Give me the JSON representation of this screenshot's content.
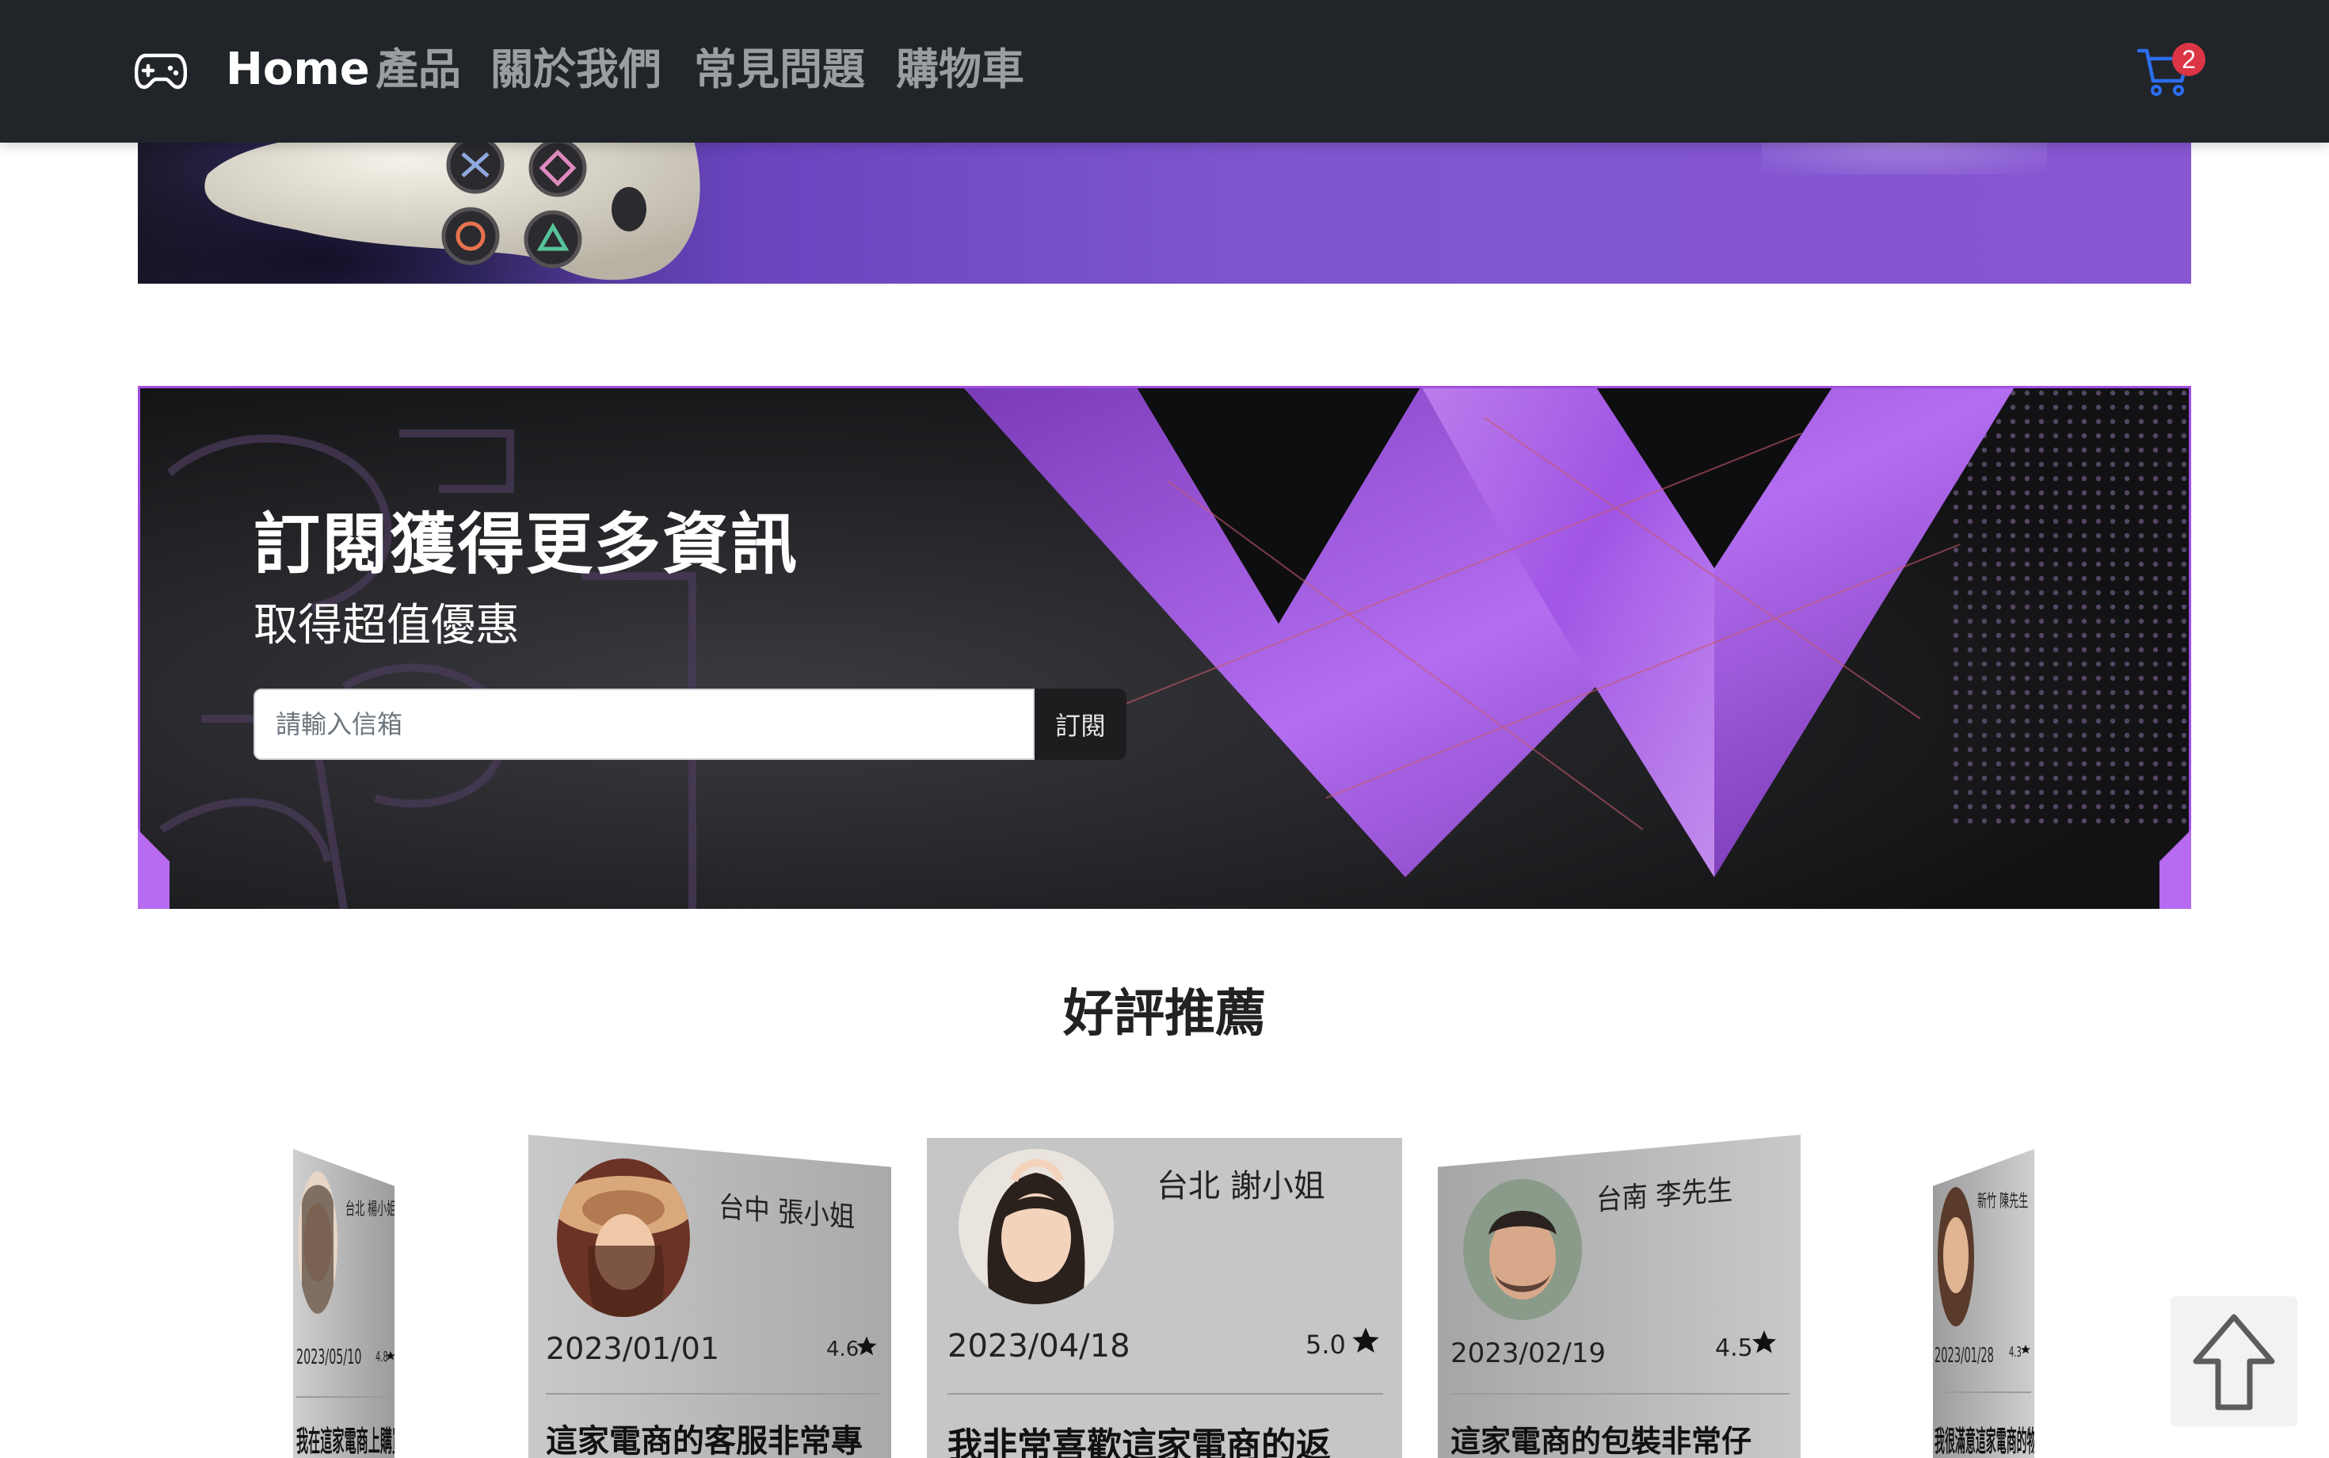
{
  "navbar": {
    "brand_icon": "gamepad-icon",
    "home_label": "Home",
    "links": [
      "產品",
      "關於我們",
      "常見問題",
      "購物車"
    ],
    "cart_icon": "cart-icon",
    "cart_count": "2",
    "colors": {
      "background": "#212529",
      "cart_icon": "#2b6ef0",
      "badge": "#dc3545"
    }
  },
  "subscribe": {
    "title": "訂閱獲得更多資訊",
    "subtitle": "取得超值優惠",
    "email_placeholder": "請輸入信箱",
    "button_label": "訂閱",
    "accent_color": "#a24ee0"
  },
  "reviews": {
    "title": "好評推薦",
    "star_icon": "star-icon",
    "items": [
      {
        "name": "台北 楊小姐",
        "date": "2023/05/10",
        "rating": "4.8",
        "excerpt": "我在這家電商上購買的產"
      },
      {
        "name": "台中 張小姐",
        "date": "2023/01/01",
        "rating": "4.6",
        "excerpt": "這家電商的客服非常專"
      },
      {
        "name": "台北 謝小姐",
        "date": "2023/04/18",
        "rating": "5.0",
        "excerpt": "我非常喜歡這家電商的返"
      },
      {
        "name": "台南 李先生",
        "date": "2023/02/19",
        "rating": "4.5",
        "excerpt": "這家電商的包裝非常仔"
      },
      {
        "name": "新竹 陳先生",
        "date": "2023/01/28",
        "rating": "4.3",
        "excerpt": "我很滿意這家電商的物流"
      }
    ]
  },
  "back_to_top_icon": "arrow-up-icon"
}
